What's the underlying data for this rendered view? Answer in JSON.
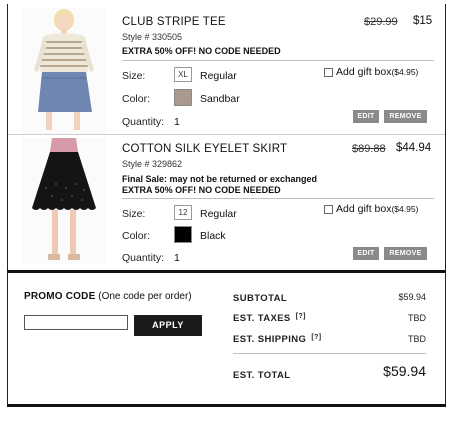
{
  "items": [
    {
      "name": "CLUB STRIPE TEE",
      "style": "Style # 330505",
      "promo": "EXTRA 50% OFF! NO CODE NEEDED",
      "final_sale": "",
      "price_old": "$29.99",
      "price_new": "$15",
      "size_label": "Size:",
      "size_code": "XL",
      "size_value": "Regular",
      "color_label": "Color:",
      "color_value": "Sandbar",
      "color_hex": "#a89a8c",
      "qty_label": "Quantity:",
      "qty_value": "1",
      "gift_label": "Add gift box",
      "gift_price": "($4.95)",
      "edit_label": "EDIT",
      "remove_label": "REMOVE"
    },
    {
      "name": "COTTON SILK EYELET SKIRT",
      "style": "Style # 329862",
      "promo": "EXTRA 50% OFF! NO CODE NEEDED",
      "final_sale": "Final Sale: may not be returned or exchanged",
      "price_old": "$89.88",
      "price_new": "$44.94",
      "size_label": "Size:",
      "size_code": "12",
      "size_value": "Regular",
      "color_label": "Color:",
      "color_value": "Black",
      "color_hex": "#000000",
      "qty_label": "Quantity:",
      "qty_value": "1",
      "gift_label": "Add gift box",
      "gift_price": "($4.95)",
      "edit_label": "EDIT",
      "remove_label": "REMOVE"
    }
  ],
  "promo": {
    "title": "PROMO CODE",
    "note": "(One code per order)",
    "input_value": "",
    "apply_label": "APPLY"
  },
  "summary": {
    "subtotal_label": "SUBTOTAL",
    "subtotal_value": "$59.94",
    "taxes_label": "EST. TAXES",
    "taxes_help": "[?]",
    "taxes_value": "TBD",
    "shipping_label": "EST. SHIPPING",
    "shipping_help": "[?]",
    "shipping_value": "TBD",
    "total_label": "EST. TOTAL",
    "total_value": "$59.94"
  }
}
